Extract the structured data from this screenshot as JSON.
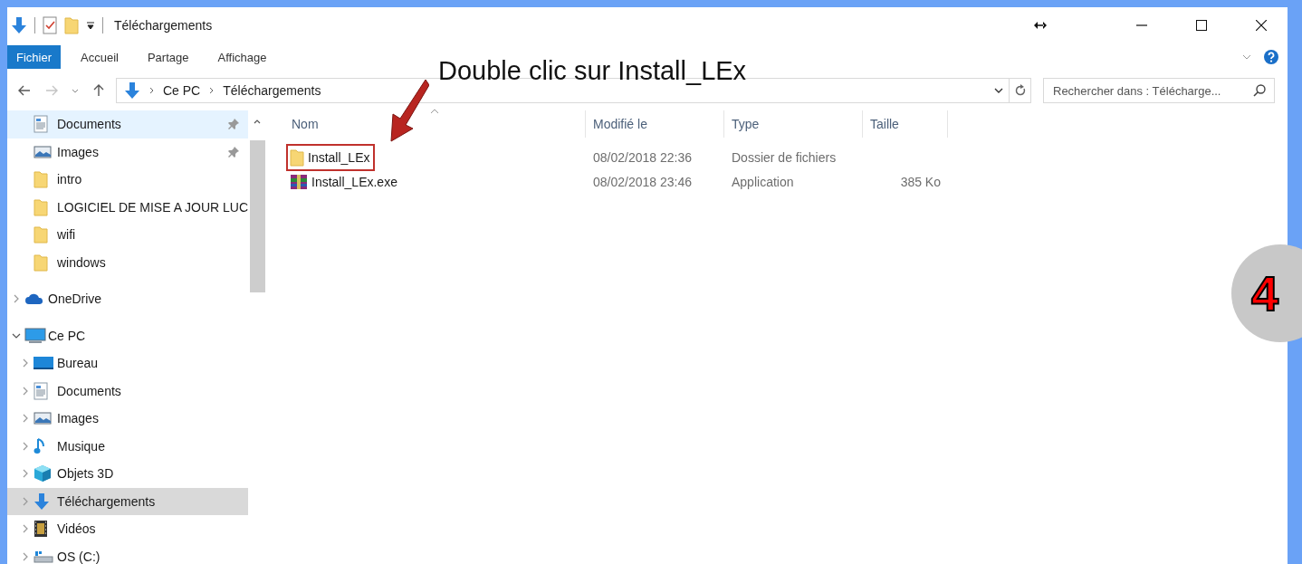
{
  "title_bar": {
    "title": "Téléchargements"
  },
  "ribbon": {
    "tabs": [
      {
        "label": "Fichier",
        "selected": true
      },
      {
        "label": "Accueil",
        "selected": false
      },
      {
        "label": "Partage",
        "selected": false
      },
      {
        "label": "Affichage",
        "selected": false
      }
    ]
  },
  "address_bar": {
    "path": [
      "Ce PC",
      "Téléchargements"
    ],
    "search_placeholder": "Rechercher dans : Télécharge..."
  },
  "navigation": {
    "quick_access": [
      {
        "kind": "documents",
        "label": "Documents",
        "pinned": true,
        "selected": false
      },
      {
        "kind": "pictures",
        "label": "Images",
        "pinned": true,
        "selected": false
      },
      {
        "kind": "folder",
        "label": "intro",
        "pinned": false,
        "selected": false
      },
      {
        "kind": "folder",
        "label": "LOGICIEL DE MISE A JOUR LUC",
        "pinned": false,
        "selected": false
      },
      {
        "kind": "folder",
        "label": "wifi",
        "pinned": false,
        "selected": false
      },
      {
        "kind": "folder",
        "label": "windows",
        "pinned": false,
        "selected": false
      }
    ],
    "tree": [
      {
        "kind": "cloud",
        "label": "OneDrive",
        "expanded": false,
        "selected": false
      },
      {
        "kind": "pc",
        "label": "Ce PC",
        "expanded": true,
        "selected": false,
        "children": [
          {
            "kind": "desktop",
            "label": "Bureau",
            "expanded": false,
            "selected": false
          },
          {
            "kind": "documents",
            "label": "Documents",
            "expanded": false,
            "selected": false
          },
          {
            "kind": "pictures",
            "label": "Images",
            "expanded": false,
            "selected": false
          },
          {
            "kind": "music",
            "label": "Musique",
            "expanded": false,
            "selected": false
          },
          {
            "kind": "objects3d",
            "label": "Objets 3D",
            "expanded": false,
            "selected": false
          },
          {
            "kind": "download",
            "label": "Téléchargements",
            "expanded": false,
            "selected": true
          },
          {
            "kind": "video",
            "label": "Vidéos",
            "expanded": false,
            "selected": false
          },
          {
            "kind": "drive",
            "label": "OS (C:)",
            "expanded": false,
            "selected": false
          }
        ]
      }
    ]
  },
  "files": {
    "columns": [
      {
        "label": "Nom",
        "sorted": true
      },
      {
        "label": "Modifié le",
        "sorted": false
      },
      {
        "label": "Type",
        "sorted": false
      },
      {
        "label": "Taille",
        "sorted": false
      }
    ],
    "rows": [
      {
        "kind": "folder",
        "name": "Install_LEx",
        "modified": "08/02/2018 22:36",
        "type": "Dossier de fichiers",
        "highlighted": true
      },
      {
        "kind": "archive",
        "name": "Install_LEx.exe",
        "modified": "08/02/2018 23:46",
        "type": "Application",
        "size": "385 Ko",
        "highlighted": false
      }
    ]
  },
  "annotation": {
    "text": "Double clic sur Install_LEx",
    "step": "4"
  }
}
